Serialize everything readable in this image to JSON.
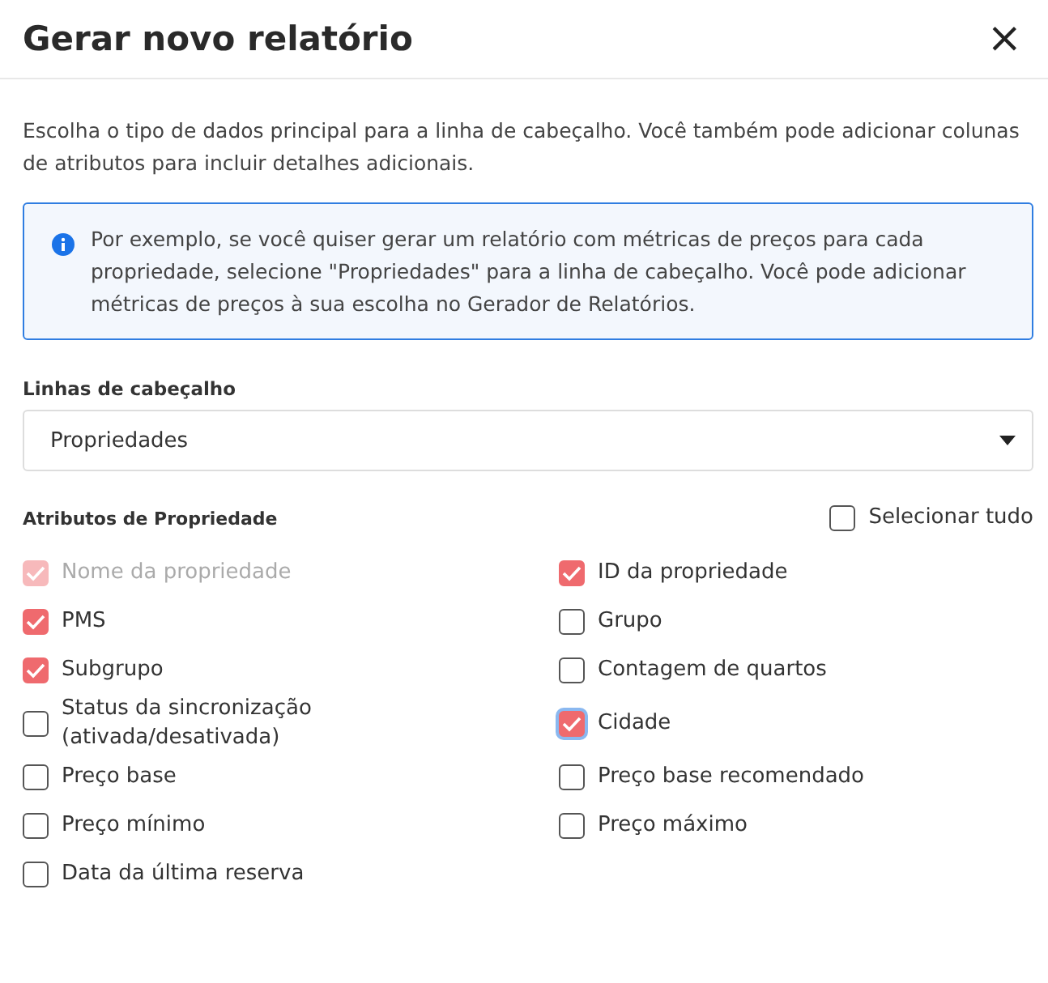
{
  "dialog": {
    "title": "Gerar novo relatório",
    "close": "×"
  },
  "intro": "Escolha o tipo de dados principal para a linha de cabeçalho. Você também pode adicionar colunas de atributos para incluir detalhes adicionais.",
  "info": {
    "text": "Por exemplo, se você quiser gerar um relatório com métricas de preços para cada propriedade, selecione \"Propriedades\" para a linha de cabeçalho. Você pode adicionar métricas de preços à sua escolha no Gerador de Relatórios."
  },
  "header_rows": {
    "label": "Linhas de cabeçalho",
    "value": "Propriedades"
  },
  "attributes": {
    "title": "Atributos de Propriedade",
    "select_all": {
      "label": "Selecionar tudo",
      "checked": false
    },
    "items": [
      {
        "label": "Nome da propriedade",
        "checked": true,
        "disabled": true,
        "focused": false
      },
      {
        "label": "ID da propriedade",
        "checked": true,
        "disabled": false,
        "focused": false
      },
      {
        "label": "PMS",
        "checked": true,
        "disabled": false,
        "focused": false
      },
      {
        "label": "Grupo",
        "checked": false,
        "disabled": false,
        "focused": false
      },
      {
        "label": "Subgrupo",
        "checked": true,
        "disabled": false,
        "focused": false
      },
      {
        "label": "Contagem de quartos",
        "checked": false,
        "disabled": false,
        "focused": false
      },
      {
        "label": "Status da sincronização (ativada/desativada)",
        "checked": false,
        "disabled": false,
        "focused": false
      },
      {
        "label": "Cidade",
        "checked": true,
        "disabled": false,
        "focused": true
      },
      {
        "label": "Preço base",
        "checked": false,
        "disabled": false,
        "focused": false
      },
      {
        "label": "Preço base recomendado",
        "checked": false,
        "disabled": false,
        "focused": false
      },
      {
        "label": "Preço mínimo",
        "checked": false,
        "disabled": false,
        "focused": false
      },
      {
        "label": "Preço máximo",
        "checked": false,
        "disabled": false,
        "focused": false
      },
      {
        "label": "Data da última reserva",
        "checked": false,
        "disabled": false,
        "focused": false
      }
    ]
  }
}
